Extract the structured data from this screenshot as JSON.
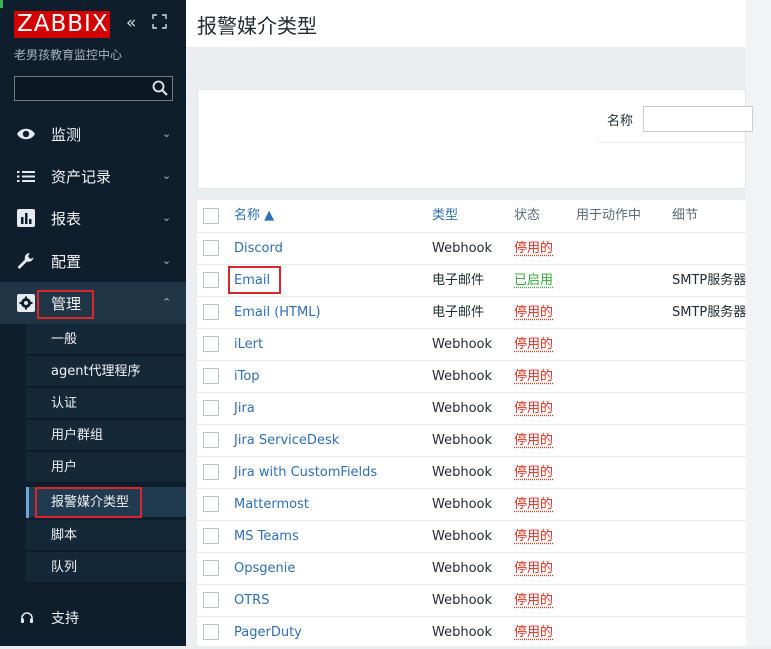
{
  "sidebar": {
    "logo": "ZABBIX",
    "collapse_glyph": "«",
    "subtitle": "老男孩教育监控中心",
    "search": {
      "value": "",
      "placeholder": ""
    },
    "nav": [
      {
        "label": "监测",
        "icon": "eye-icon",
        "chevron": "⌄"
      },
      {
        "label": "资产记录",
        "icon": "list-icon",
        "chevron": "⌄"
      },
      {
        "label": "报表",
        "icon": "report-chart-icon",
        "chevron": "⌄"
      },
      {
        "label": "配置",
        "icon": "wrench-icon",
        "chevron": "⌄"
      },
      {
        "label": "管理",
        "icon": "gear-icon",
        "chevron": "⌃"
      }
    ],
    "admin_submenu": [
      "一般",
      "agent代理程序",
      "认证",
      "用户群组",
      "用户",
      "报警媒介类型",
      "脚本",
      "队列"
    ],
    "support": {
      "label": "支持",
      "icon": "headset-icon"
    }
  },
  "page": {
    "title": "报警媒介类型",
    "filter": {
      "name_label": "名称",
      "name_value": ""
    }
  },
  "table": {
    "headers": {
      "name": "名称 ▲",
      "type": "类型",
      "status": "状态",
      "used_in_actions": "用于动作中",
      "details": "细节"
    },
    "rows": [
      {
        "name": "Discord",
        "type": "Webhook",
        "status": "停用的",
        "details": ""
      },
      {
        "name": "Email",
        "type": "电子邮件",
        "status": "已启用",
        "details": "SMTP服务器"
      },
      {
        "name": "Email (HTML)",
        "type": "电子邮件",
        "status": "停用的",
        "details": "SMTP服务器"
      },
      {
        "name": "iLert",
        "type": "Webhook",
        "status": "停用的",
        "details": ""
      },
      {
        "name": "iTop",
        "type": "Webhook",
        "status": "停用的",
        "details": ""
      },
      {
        "name": "Jira",
        "type": "Webhook",
        "status": "停用的",
        "details": ""
      },
      {
        "name": "Jira ServiceDesk",
        "type": "Webhook",
        "status": "停用的",
        "details": ""
      },
      {
        "name": "Jira with CustomFields",
        "type": "Webhook",
        "status": "停用的",
        "details": ""
      },
      {
        "name": "Mattermost",
        "type": "Webhook",
        "status": "停用的",
        "details": ""
      },
      {
        "name": "MS Teams",
        "type": "Webhook",
        "status": "停用的",
        "details": ""
      },
      {
        "name": "Opsgenie",
        "type": "Webhook",
        "status": "停用的",
        "details": ""
      },
      {
        "name": "OTRS",
        "type": "Webhook",
        "status": "停用的",
        "details": ""
      },
      {
        "name": "PagerDuty",
        "type": "Webhook",
        "status": "停用的",
        "details": ""
      }
    ]
  },
  "colors": {
    "sidebar_bg": "#0f1e2c",
    "brand_red": "#d40000",
    "link_blue": "#2f6fb5",
    "status_disabled": "#e0301e",
    "status_enabled": "#3aa83a",
    "highlight_box": "#d9262c"
  }
}
